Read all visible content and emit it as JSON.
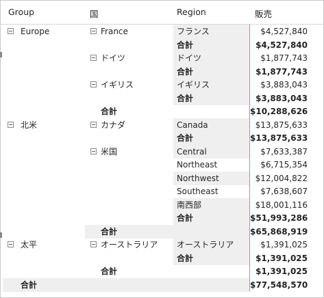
{
  "headers": {
    "group": "Group",
    "country": "国",
    "region": "Region",
    "sales": "販売"
  },
  "groups": [
    {
      "name": "Europe",
      "countries": [
        {
          "name": "France",
          "rows": [
            {
              "region": "フランス",
              "value": "$4,527,840"
            }
          ],
          "total_label": "合計",
          "total": "$4,527,840"
        },
        {
          "name": "ドイツ",
          "rows": [
            {
              "region": "ドイツ",
              "value": "$1,877,743"
            }
          ],
          "total_label": "合計",
          "total": "$1,877,743"
        },
        {
          "name": "イギリス",
          "rows": [
            {
              "region": "イギリス",
              "value": "$3,883,043"
            }
          ],
          "total_label": "合計",
          "total": "$3,883,043"
        }
      ],
      "total_label": "合計",
      "total": "$10,288,626"
    },
    {
      "name": "北米",
      "countries": [
        {
          "name": "カナダ",
          "rows": [
            {
              "region": "Canada",
              "value": "$13,875,633"
            }
          ],
          "total_label": "合計",
          "total": "$13,875,633"
        },
        {
          "name": "米国",
          "rows": [
            {
              "region": "Central",
              "value": "$7,633,387"
            },
            {
              "region": "Northeast",
              "value": "$6,715,354"
            },
            {
              "region": "Northwest",
              "value": "$12,004,822"
            },
            {
              "region": "Southeast",
              "value": "$7,638,607"
            },
            {
              "region": "南西部",
              "value": "$18,001,116"
            }
          ],
          "total_label": "合計",
          "total": "$51,993,286"
        }
      ],
      "total_label": "合計",
      "total": "$65,868,919"
    },
    {
      "name": "太平",
      "countries": [
        {
          "name": "オーストラリア",
          "rows": [
            {
              "region": "オーストラリア",
              "value": "$1,391,025"
            }
          ],
          "total_label": "合計",
          "total": "$1,391,025"
        }
      ],
      "total_label": "合計",
      "total": "$1,391,025"
    }
  ],
  "grand_total_label": "合計",
  "grand_total": "$77,548,570"
}
